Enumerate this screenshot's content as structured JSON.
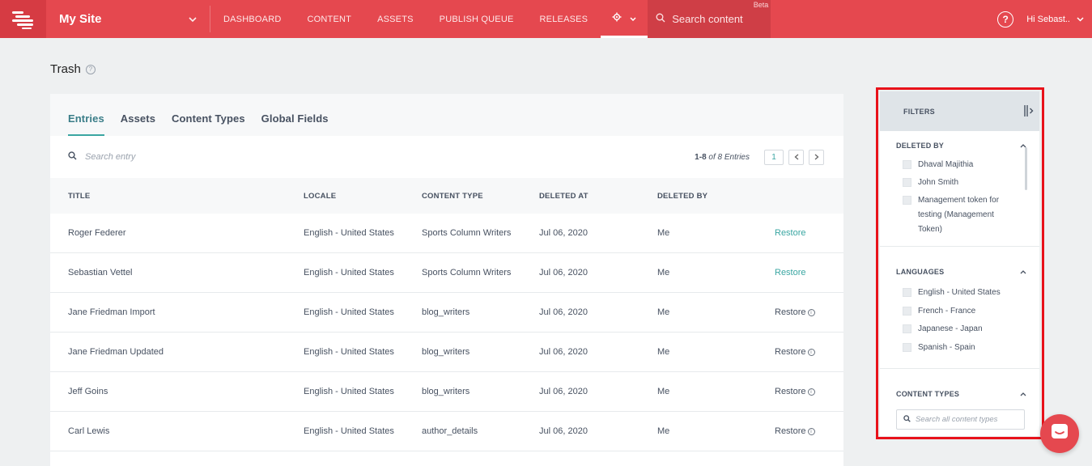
{
  "topbar": {
    "site_name": "My Site",
    "nav": [
      "DASHBOARD",
      "CONTENT",
      "ASSETS",
      "PUBLISH QUEUE",
      "RELEASES"
    ],
    "search_placeholder": "Search content",
    "beta": "Beta",
    "help": "?",
    "user": "Hi Sebast..",
    "colors": {
      "bar": "#e5484f",
      "accent": "#3aa6a2"
    }
  },
  "page": {
    "title": "Trash"
  },
  "tabs": [
    "Entries",
    "Assets",
    "Content Types",
    "Global Fields"
  ],
  "search": {
    "placeholder": "Search entry",
    "range": "1-8",
    "of_text": "of 8 Entries",
    "page": "1"
  },
  "table": {
    "headers": [
      "TITLE",
      "LOCALE",
      "CONTENT TYPE",
      "DELETED AT",
      "DELETED BY"
    ],
    "rows": [
      {
        "title": "Roger Federer",
        "locale": "English - United States",
        "type": "Sports Column Writers",
        "deleted_at": "Jul 06, 2020",
        "deleted_by": "Me",
        "action": "Restore"
      },
      {
        "title": "Sebastian Vettel",
        "locale": "English - United States",
        "type": "Sports Column Writers",
        "deleted_at": "Jul 06, 2020",
        "deleted_by": "Me",
        "action": "Restore"
      },
      {
        "title": "Jane Friedman Import",
        "locale": "English - United States",
        "type": "blog_writers",
        "deleted_at": "Jul 06, 2020",
        "deleted_by": "Me",
        "action": "Restore"
      },
      {
        "title": "Jane Friedman Updated",
        "locale": "English - United States",
        "type": "blog_writers",
        "deleted_at": "Jul 06, 2020",
        "deleted_by": "Me",
        "action": "Restore"
      },
      {
        "title": "Jeff Goins",
        "locale": "English - United States",
        "type": "blog_writers",
        "deleted_at": "Jul 06, 2020",
        "deleted_by": "Me",
        "action": "Restore"
      },
      {
        "title": "Carl Lewis",
        "locale": "English - United States",
        "type": "author_details",
        "deleted_at": "Jul 06, 2020",
        "deleted_by": "Me",
        "action": "Restore"
      }
    ]
  },
  "filters": {
    "title": "FILTERS",
    "deleted_by": {
      "title": "DELETED BY",
      "items": [
        "Dhaval Majithia",
        "John Smith",
        "Management token for testing (Management Token)"
      ]
    },
    "languages": {
      "title": "LANGUAGES",
      "items": [
        "English - United States",
        "French - France",
        "Japanese - Japan",
        "Spanish - Spain"
      ]
    },
    "content_types": {
      "title": "CONTENT TYPES",
      "placeholder": "Search all content types"
    }
  }
}
